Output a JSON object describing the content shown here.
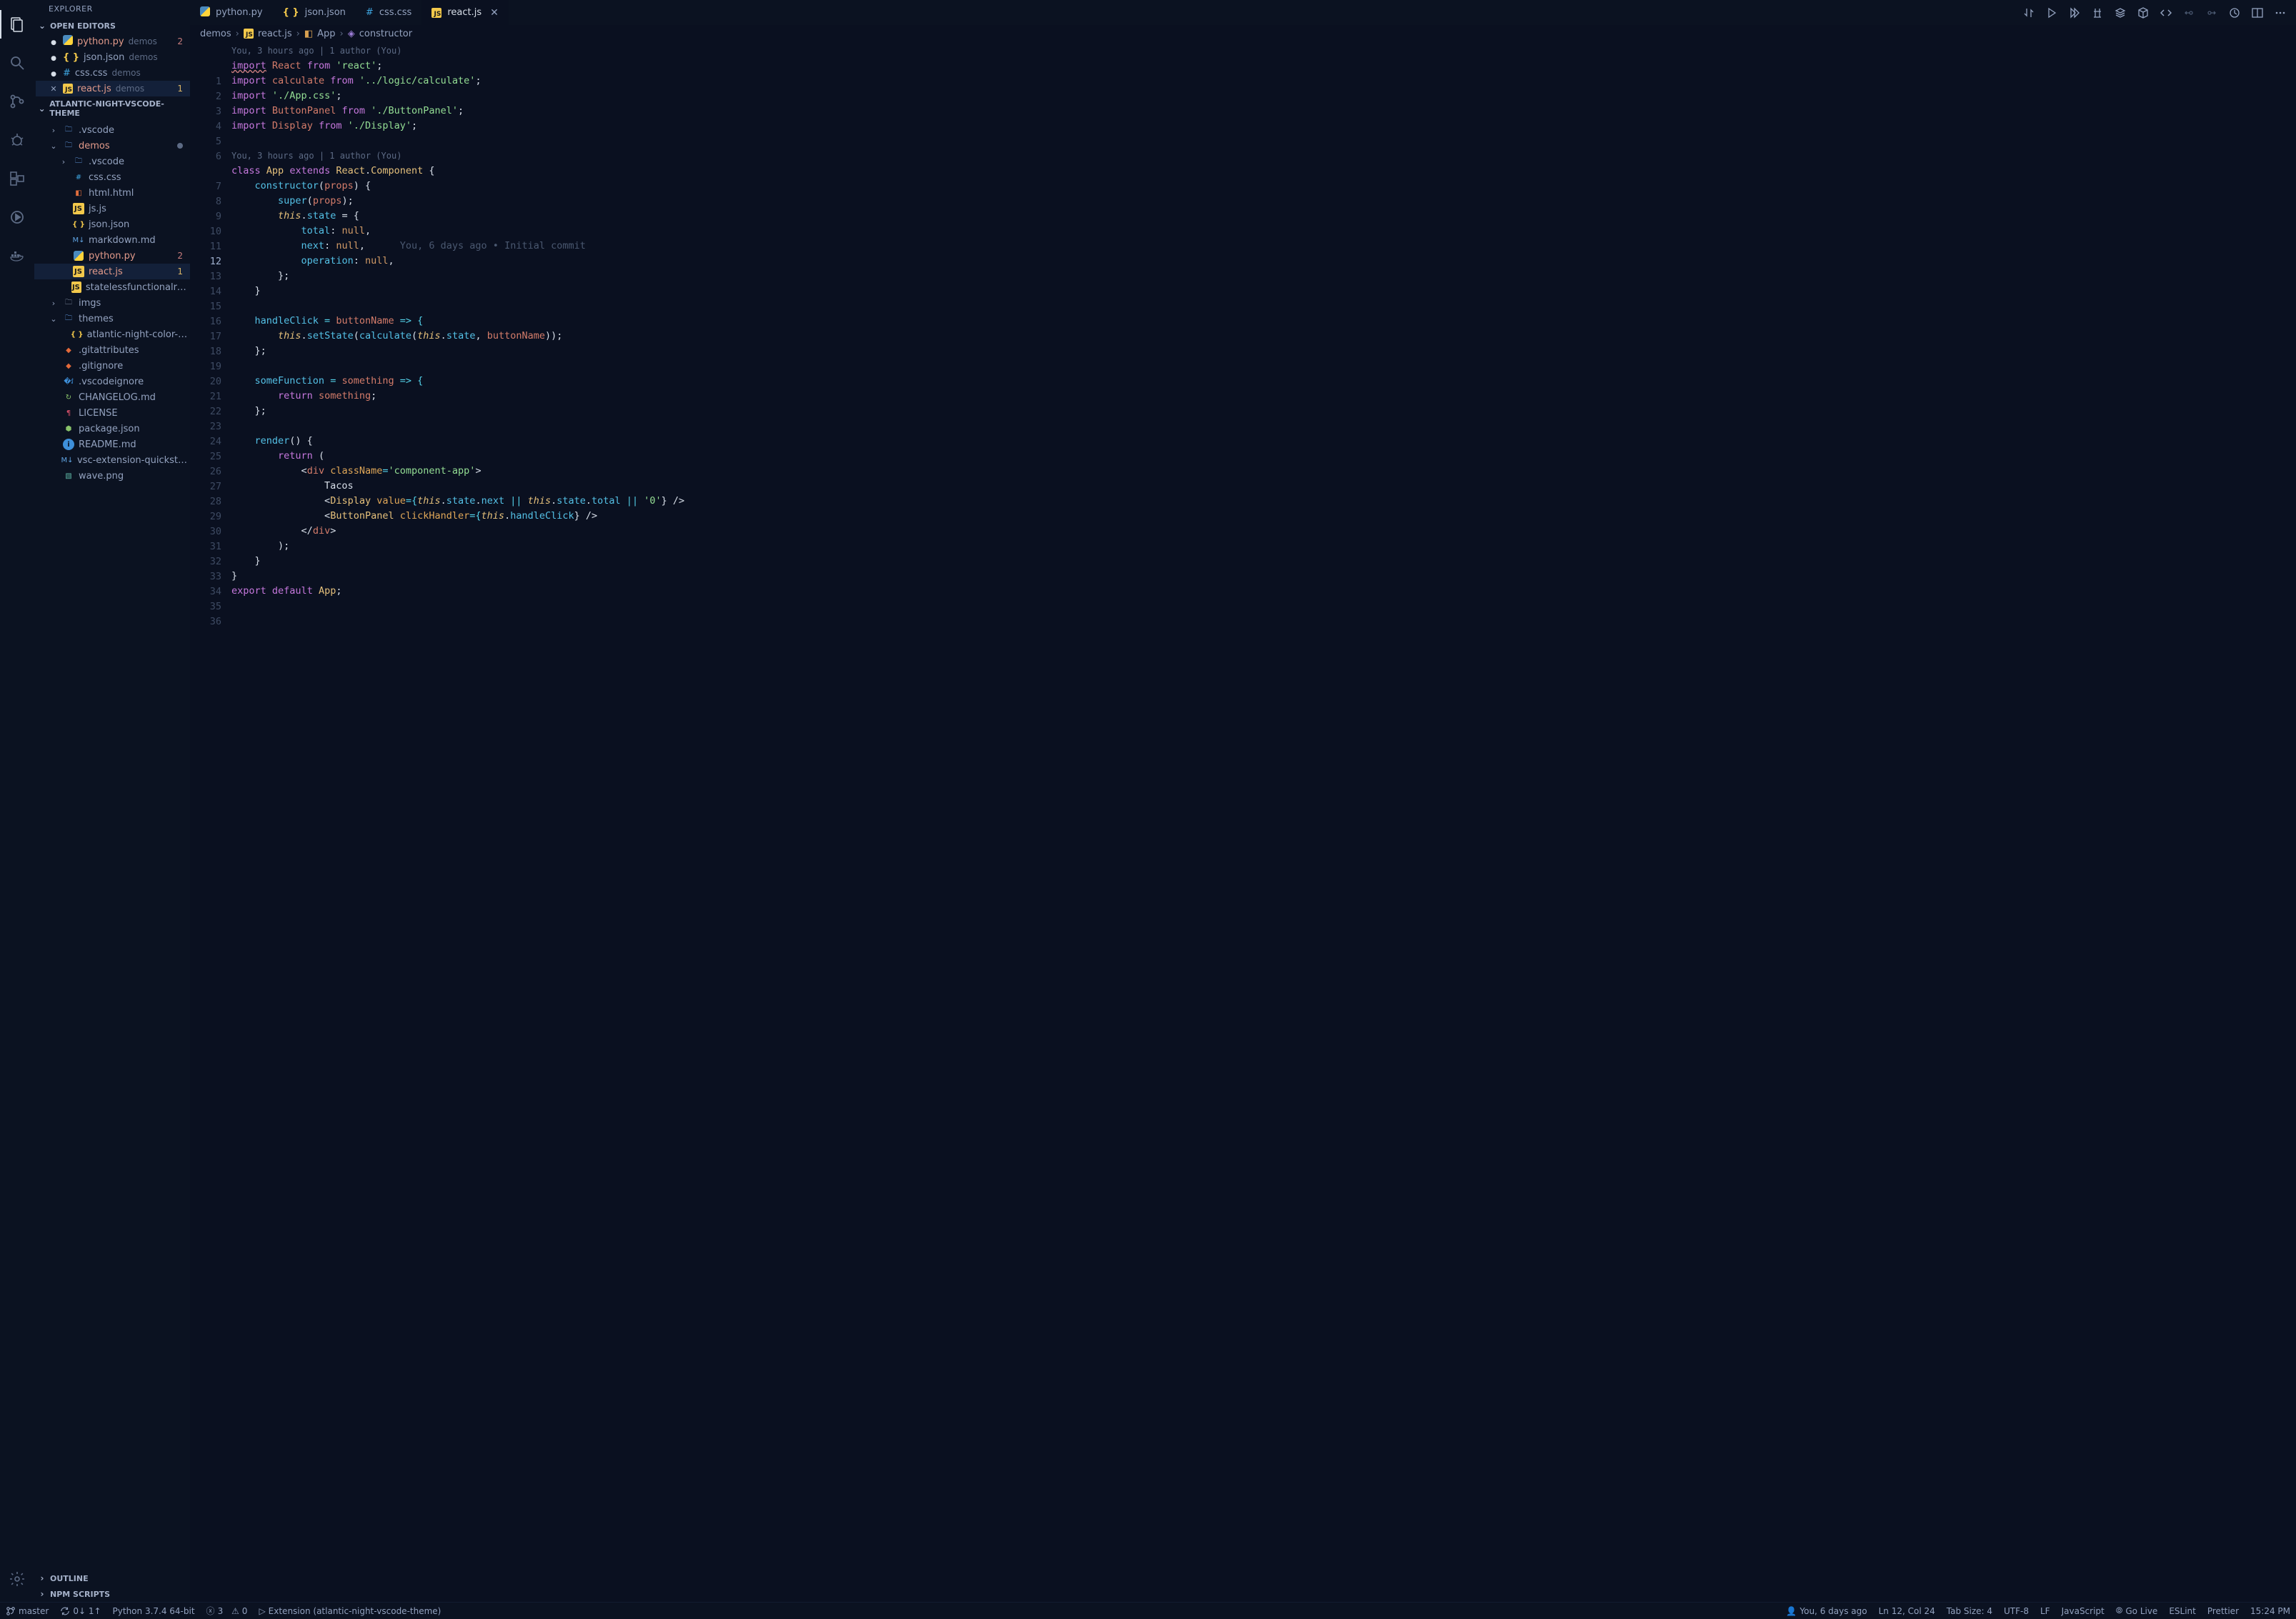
{
  "explorer": {
    "title": "EXPLORER"
  },
  "open_editors": {
    "header": "OPEN EDITORS",
    "items": [
      {
        "name": "python.py",
        "dir": "demos",
        "badge": "2",
        "badgeType": "err",
        "icon": "py",
        "modified": true
      },
      {
        "name": "json.json",
        "dir": "demos",
        "icon": "json"
      },
      {
        "name": "css.css",
        "dir": "demos",
        "icon": "css"
      },
      {
        "name": "react.js",
        "dir": "demos",
        "badge": "1",
        "badgeType": "warn",
        "icon": "js",
        "modified": true,
        "active": true,
        "closeVisible": true
      }
    ]
  },
  "folder_section": {
    "header": "ATLANTIC-NIGHT-VSCODE-THEME"
  },
  "tree": [
    {
      "depth": 1,
      "type": "folder",
      "open": false,
      "label": ".vscode",
      "icon": "folder"
    },
    {
      "depth": 1,
      "type": "folder",
      "open": true,
      "label": "demos",
      "icon": "folder",
      "modified": true,
      "moddot": true
    },
    {
      "depth": 2,
      "type": "folder",
      "open": false,
      "label": ".vscode",
      "icon": "folder"
    },
    {
      "depth": 2,
      "type": "file",
      "label": "css.css",
      "icon": "css"
    },
    {
      "depth": 2,
      "type": "file",
      "label": "html.html",
      "icon": "html"
    },
    {
      "depth": 2,
      "type": "file",
      "label": "js.js",
      "icon": "js"
    },
    {
      "depth": 2,
      "type": "file",
      "label": "json.json",
      "icon": "json"
    },
    {
      "depth": 2,
      "type": "file",
      "label": "markdown.md",
      "icon": "md"
    },
    {
      "depth": 2,
      "type": "file",
      "label": "python.py",
      "icon": "py",
      "modified": true,
      "badge": "2",
      "badgeType": "err"
    },
    {
      "depth": 2,
      "type": "file",
      "label": "react.js",
      "icon": "js",
      "modified": true,
      "selected": true,
      "badge": "1",
      "badgeType": "warn"
    },
    {
      "depth": 2,
      "type": "file",
      "label": "statelessfunctionalreact.js",
      "icon": "js"
    },
    {
      "depth": 1,
      "type": "folder",
      "open": false,
      "label": "imgs",
      "icon": "folder-plain"
    },
    {
      "depth": 1,
      "type": "folder",
      "open": true,
      "label": "themes",
      "icon": "folder"
    },
    {
      "depth": 2,
      "type": "file",
      "label": "atlantic-night-color-them...",
      "icon": "json"
    },
    {
      "depth": 1,
      "type": "file",
      "label": ".gitattributes",
      "icon": "git"
    },
    {
      "depth": 1,
      "type": "file",
      "label": ".gitignore",
      "icon": "git"
    },
    {
      "depth": 1,
      "type": "file",
      "label": ".vscodeignore",
      "icon": "vs"
    },
    {
      "depth": 1,
      "type": "file",
      "label": "CHANGELOG.md",
      "icon": "history"
    },
    {
      "depth": 1,
      "type": "file",
      "label": "LICENSE",
      "icon": "yaml"
    },
    {
      "depth": 1,
      "type": "file",
      "label": "package.json",
      "icon": "ext"
    },
    {
      "depth": 1,
      "type": "file",
      "label": "README.md",
      "icon": "info"
    },
    {
      "depth": 1,
      "type": "file",
      "label": "vsc-extension-quickstart.md",
      "icon": "md"
    },
    {
      "depth": 1,
      "type": "file",
      "label": "wave.png",
      "icon": "img"
    }
  ],
  "outline": {
    "header": "OUTLINE"
  },
  "npm": {
    "header": "NPM SCRIPTS"
  },
  "tabs": [
    {
      "label": "python.py",
      "icon": "py"
    },
    {
      "label": "json.json",
      "icon": "json"
    },
    {
      "label": "css.css",
      "icon": "css"
    },
    {
      "label": "react.js",
      "icon": "js",
      "active": true,
      "close": "✕"
    }
  ],
  "breadcrumbs": [
    "demos",
    "react.js",
    "App",
    "constructor"
  ],
  "code": {
    "lens1": "You, 3 hours ago | 1 author (You)",
    "lens2": "You, 3 hours ago | 1 author (You)",
    "blame12": "You, 6 days ago • Initial commit",
    "line_count": 36,
    "current_line": 12,
    "l1": {
      "a": "import",
      "b": "React",
      "c": "from",
      "d": "'react'",
      "e": ";"
    },
    "l2": {
      "a": "import",
      "b": "calculate",
      "c": "from",
      "d": "'../logic/calculate'",
      "e": ";"
    },
    "l3": {
      "a": "import",
      "d": "'./App.css'",
      "e": ";"
    },
    "l4": {
      "a": "import",
      "b": "ButtonPanel",
      "c": "from",
      "d": "'./ButtonPanel'",
      "e": ";"
    },
    "l5": {
      "a": "import",
      "b": "Display",
      "c": "from",
      "d": "'./Display'",
      "e": ";"
    },
    "l7": {
      "a": "class",
      "b": "App",
      "c": "extends",
      "d": "React",
      "e": ".",
      "f": "Component",
      "g": " {"
    },
    "l8": {
      "a": "constructor",
      "b": "(",
      "c": "props",
      "d": ") {"
    },
    "l9": {
      "a": "super",
      "b": "(",
      "c": "props",
      "d": ");"
    },
    "l10": {
      "a": "this",
      "b": ".",
      "c": "state",
      "d": " = {"
    },
    "l11": {
      "a": "total",
      "b": ": ",
      "c": "null",
      "d": ","
    },
    "l12": {
      "a": "next",
      "b": ": ",
      "c": "null",
      "d": ","
    },
    "l13": {
      "a": "operation",
      "b": ": ",
      "c": "null",
      "d": ","
    },
    "l14": "};",
    "l15": "}",
    "l17": {
      "a": "handleClick",
      "b": " = ",
      "c": "buttonName",
      "d": " => {"
    },
    "l18": {
      "a": "this",
      "b": ".",
      "c": "setState",
      "d": "(",
      "e": "calculate",
      "f": "(",
      "g": "this",
      "h": ".",
      "i": "state",
      "j": ", ",
      "k": "buttonName",
      "l": "));"
    },
    "l19": "};",
    "l21": {
      "a": "someFunction",
      "b": " = ",
      "c": "something",
      "d": " => {"
    },
    "l22": {
      "a": "return",
      "b": " ",
      "c": "something",
      "d": ";"
    },
    "l23": "};",
    "l25": {
      "a": "render",
      "b": "() {"
    },
    "l26": {
      "a": "return",
      "b": " ("
    },
    "l27": {
      "a": "<",
      "b": "div",
      "c": " ",
      "d": "className",
      "e": "=",
      "f": "'component-app'",
      "g": ">"
    },
    "l28": "Tacos",
    "l29": {
      "a": "<",
      "b": "Display",
      "c": " ",
      "d": "value",
      "e": "={",
      "f": "this",
      "g": ".",
      "h": "state",
      "i": ".",
      "j": "next",
      "k": " || ",
      "l": "this",
      "m": ".",
      "n": "state",
      "o": ".",
      "p": "total",
      "q": " || ",
      "r": "'0'",
      "s": "} />"
    },
    "l30": {
      "a": "<",
      "b": "ButtonPanel",
      "c": " ",
      "d": "clickHandler",
      "e": "={",
      "f": "this",
      "g": ".",
      "h": "handleClick",
      "i": "} />"
    },
    "l31": {
      "a": "</",
      "b": "div",
      "c": ">"
    },
    "l32": ");",
    "l33": "}",
    "l34": "}",
    "l35": {
      "a": "export",
      "b": " ",
      "c": "default",
      "d": " ",
      "e": "App",
      "f": ";"
    }
  },
  "status": {
    "branch": "master",
    "sync": "0↓ 1↑",
    "python": "Python 3.7.4 64-bit",
    "errors": "3",
    "warnings": "0",
    "extension": "Extension (atlantic-night-vscode-theme)",
    "blame": "You, 6 days ago",
    "position": "Ln 12, Col 24",
    "tabsize": "Tab Size: 4",
    "encoding": "UTF-8",
    "eol": "LF",
    "lang": "JavaScript",
    "golive": "Go Live",
    "eslint": "ESLint",
    "prettier": "Prettier",
    "clock": "15:24 PM"
  }
}
